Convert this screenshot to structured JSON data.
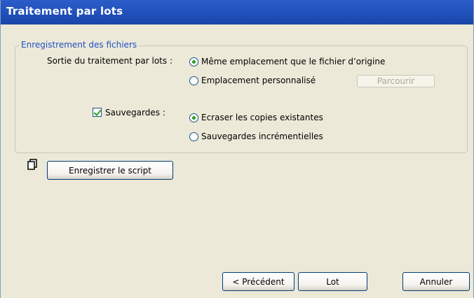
{
  "window": {
    "title": "Traitement par lots"
  },
  "group": {
    "legend": "Enregistrement des fichiers",
    "output_label": "Sortie du traitement par lots :",
    "output_options": [
      "Même emplacement que le fichier d’origine",
      "Emplacement personnalisé"
    ],
    "browse_label": "Parcourir",
    "backups_label": "Sauvegardes :",
    "backups_checked": true,
    "backup_options": [
      "Ecraser les copies existantes",
      "Sauvegardes incrémentielles"
    ]
  },
  "script_button": "Enregistrer le script",
  "icons": {
    "script": "copy-pages-icon"
  },
  "footer": {
    "back": "< Précédent",
    "ok": "Lot",
    "cancel": "Annuler"
  }
}
